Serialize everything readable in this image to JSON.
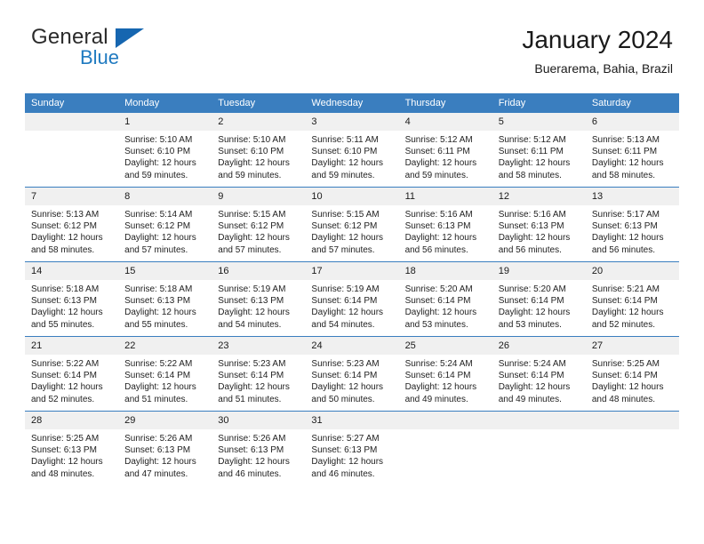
{
  "brand": {
    "name_part1": "General",
    "name_part2": "Blue",
    "triangle_color": "#1666b0",
    "blue_color": "#1f7ac0"
  },
  "header": {
    "title": "January 2024",
    "subtitle": "Buerarema, Bahia, Brazil"
  },
  "theme": {
    "header_background": "#3a7ebf",
    "header_text": "#ffffff",
    "daynum_background": "#f0f0f0",
    "grid_line": "#3a7ebf"
  },
  "calendar": {
    "weekday_headers": [
      "Sunday",
      "Monday",
      "Tuesday",
      "Wednesday",
      "Thursday",
      "Friday",
      "Saturday"
    ],
    "labels": {
      "sunrise_prefix": "Sunrise:",
      "sunset_prefix": "Sunset:",
      "daylight_prefix": "Daylight:"
    },
    "weeks": [
      [
        {
          "day": "",
          "blank": true,
          "sunrise": "",
          "sunset": "",
          "daylight_line1": "",
          "daylight_line2": ""
        },
        {
          "day": "1",
          "sunrise": "Sunrise: 5:10 AM",
          "sunset": "Sunset: 6:10 PM",
          "daylight_line1": "Daylight: 12 hours",
          "daylight_line2": "and 59 minutes."
        },
        {
          "day": "2",
          "sunrise": "Sunrise: 5:10 AM",
          "sunset": "Sunset: 6:10 PM",
          "daylight_line1": "Daylight: 12 hours",
          "daylight_line2": "and 59 minutes."
        },
        {
          "day": "3",
          "sunrise": "Sunrise: 5:11 AM",
          "sunset": "Sunset: 6:10 PM",
          "daylight_line1": "Daylight: 12 hours",
          "daylight_line2": "and 59 minutes."
        },
        {
          "day": "4",
          "sunrise": "Sunrise: 5:12 AM",
          "sunset": "Sunset: 6:11 PM",
          "daylight_line1": "Daylight: 12 hours",
          "daylight_line2": "and 59 minutes."
        },
        {
          "day": "5",
          "sunrise": "Sunrise: 5:12 AM",
          "sunset": "Sunset: 6:11 PM",
          "daylight_line1": "Daylight: 12 hours",
          "daylight_line2": "and 58 minutes."
        },
        {
          "day": "6",
          "sunrise": "Sunrise: 5:13 AM",
          "sunset": "Sunset: 6:11 PM",
          "daylight_line1": "Daylight: 12 hours",
          "daylight_line2": "and 58 minutes."
        }
      ],
      [
        {
          "day": "7",
          "sunrise": "Sunrise: 5:13 AM",
          "sunset": "Sunset: 6:12 PM",
          "daylight_line1": "Daylight: 12 hours",
          "daylight_line2": "and 58 minutes."
        },
        {
          "day": "8",
          "sunrise": "Sunrise: 5:14 AM",
          "sunset": "Sunset: 6:12 PM",
          "daylight_line1": "Daylight: 12 hours",
          "daylight_line2": "and 57 minutes."
        },
        {
          "day": "9",
          "sunrise": "Sunrise: 5:15 AM",
          "sunset": "Sunset: 6:12 PM",
          "daylight_line1": "Daylight: 12 hours",
          "daylight_line2": "and 57 minutes."
        },
        {
          "day": "10",
          "sunrise": "Sunrise: 5:15 AM",
          "sunset": "Sunset: 6:12 PM",
          "daylight_line1": "Daylight: 12 hours",
          "daylight_line2": "and 57 minutes."
        },
        {
          "day": "11",
          "sunrise": "Sunrise: 5:16 AM",
          "sunset": "Sunset: 6:13 PM",
          "daylight_line1": "Daylight: 12 hours",
          "daylight_line2": "and 56 minutes."
        },
        {
          "day": "12",
          "sunrise": "Sunrise: 5:16 AM",
          "sunset": "Sunset: 6:13 PM",
          "daylight_line1": "Daylight: 12 hours",
          "daylight_line2": "and 56 minutes."
        },
        {
          "day": "13",
          "sunrise": "Sunrise: 5:17 AM",
          "sunset": "Sunset: 6:13 PM",
          "daylight_line1": "Daylight: 12 hours",
          "daylight_line2": "and 56 minutes."
        }
      ],
      [
        {
          "day": "14",
          "sunrise": "Sunrise: 5:18 AM",
          "sunset": "Sunset: 6:13 PM",
          "daylight_line1": "Daylight: 12 hours",
          "daylight_line2": "and 55 minutes."
        },
        {
          "day": "15",
          "sunrise": "Sunrise: 5:18 AM",
          "sunset": "Sunset: 6:13 PM",
          "daylight_line1": "Daylight: 12 hours",
          "daylight_line2": "and 55 minutes."
        },
        {
          "day": "16",
          "sunrise": "Sunrise: 5:19 AM",
          "sunset": "Sunset: 6:13 PM",
          "daylight_line1": "Daylight: 12 hours",
          "daylight_line2": "and 54 minutes."
        },
        {
          "day": "17",
          "sunrise": "Sunrise: 5:19 AM",
          "sunset": "Sunset: 6:14 PM",
          "daylight_line1": "Daylight: 12 hours",
          "daylight_line2": "and 54 minutes."
        },
        {
          "day": "18",
          "sunrise": "Sunrise: 5:20 AM",
          "sunset": "Sunset: 6:14 PM",
          "daylight_line1": "Daylight: 12 hours",
          "daylight_line2": "and 53 minutes."
        },
        {
          "day": "19",
          "sunrise": "Sunrise: 5:20 AM",
          "sunset": "Sunset: 6:14 PM",
          "daylight_line1": "Daylight: 12 hours",
          "daylight_line2": "and 53 minutes."
        },
        {
          "day": "20",
          "sunrise": "Sunrise: 5:21 AM",
          "sunset": "Sunset: 6:14 PM",
          "daylight_line1": "Daylight: 12 hours",
          "daylight_line2": "and 52 minutes."
        }
      ],
      [
        {
          "day": "21",
          "sunrise": "Sunrise: 5:22 AM",
          "sunset": "Sunset: 6:14 PM",
          "daylight_line1": "Daylight: 12 hours",
          "daylight_line2": "and 52 minutes."
        },
        {
          "day": "22",
          "sunrise": "Sunrise: 5:22 AM",
          "sunset": "Sunset: 6:14 PM",
          "daylight_line1": "Daylight: 12 hours",
          "daylight_line2": "and 51 minutes."
        },
        {
          "day": "23",
          "sunrise": "Sunrise: 5:23 AM",
          "sunset": "Sunset: 6:14 PM",
          "daylight_line1": "Daylight: 12 hours",
          "daylight_line2": "and 51 minutes."
        },
        {
          "day": "24",
          "sunrise": "Sunrise: 5:23 AM",
          "sunset": "Sunset: 6:14 PM",
          "daylight_line1": "Daylight: 12 hours",
          "daylight_line2": "and 50 minutes."
        },
        {
          "day": "25",
          "sunrise": "Sunrise: 5:24 AM",
          "sunset": "Sunset: 6:14 PM",
          "daylight_line1": "Daylight: 12 hours",
          "daylight_line2": "and 49 minutes."
        },
        {
          "day": "26",
          "sunrise": "Sunrise: 5:24 AM",
          "sunset": "Sunset: 6:14 PM",
          "daylight_line1": "Daylight: 12 hours",
          "daylight_line2": "and 49 minutes."
        },
        {
          "day": "27",
          "sunrise": "Sunrise: 5:25 AM",
          "sunset": "Sunset: 6:14 PM",
          "daylight_line1": "Daylight: 12 hours",
          "daylight_line2": "and 48 minutes."
        }
      ],
      [
        {
          "day": "28",
          "sunrise": "Sunrise: 5:25 AM",
          "sunset": "Sunset: 6:13 PM",
          "daylight_line1": "Daylight: 12 hours",
          "daylight_line2": "and 48 minutes."
        },
        {
          "day": "29",
          "sunrise": "Sunrise: 5:26 AM",
          "sunset": "Sunset: 6:13 PM",
          "daylight_line1": "Daylight: 12 hours",
          "daylight_line2": "and 47 minutes."
        },
        {
          "day": "30",
          "sunrise": "Sunrise: 5:26 AM",
          "sunset": "Sunset: 6:13 PM",
          "daylight_line1": "Daylight: 12 hours",
          "daylight_line2": "and 46 minutes."
        },
        {
          "day": "31",
          "sunrise": "Sunrise: 5:27 AM",
          "sunset": "Sunset: 6:13 PM",
          "daylight_line1": "Daylight: 12 hours",
          "daylight_line2": "and 46 minutes."
        },
        {
          "day": "",
          "blank": true,
          "sunrise": "",
          "sunset": "",
          "daylight_line1": "",
          "daylight_line2": ""
        },
        {
          "day": "",
          "blank": true,
          "sunrise": "",
          "sunset": "",
          "daylight_line1": "",
          "daylight_line2": ""
        },
        {
          "day": "",
          "blank": true,
          "sunrise": "",
          "sunset": "",
          "daylight_line1": "",
          "daylight_line2": ""
        }
      ]
    ]
  }
}
